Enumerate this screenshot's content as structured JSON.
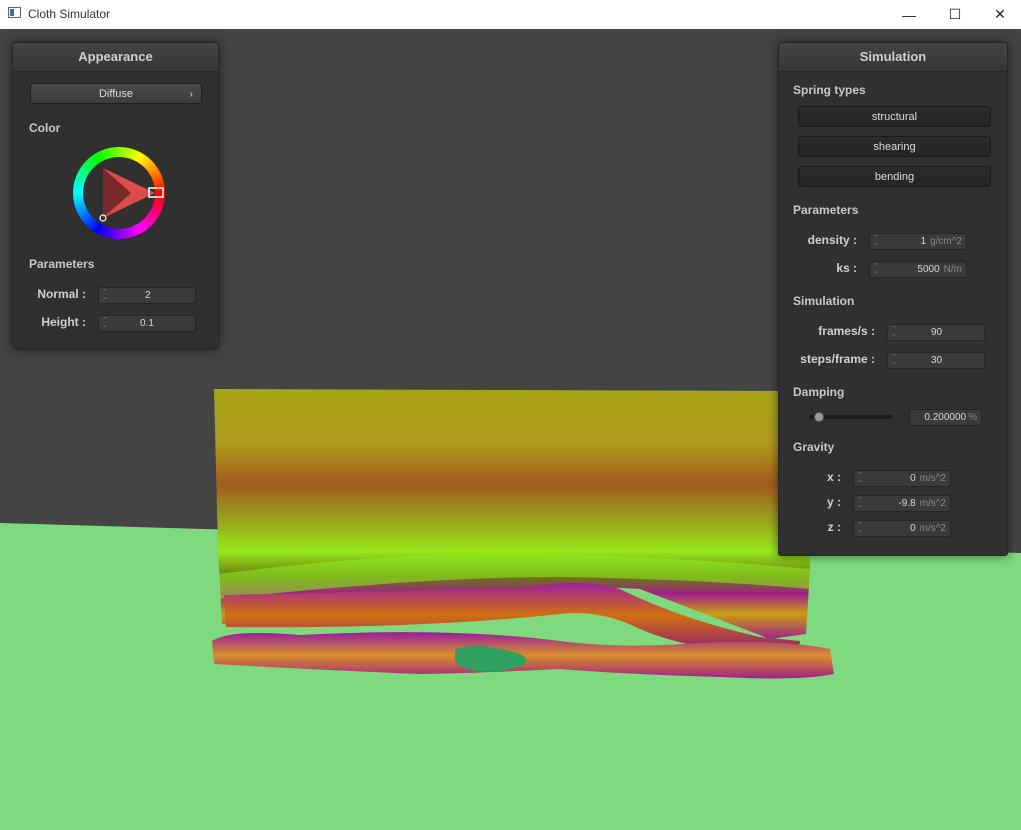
{
  "window": {
    "title": "Cloth Simulator",
    "minimize": "—",
    "maximize": "☐",
    "close": "✕"
  },
  "colors": {
    "ground": "#7ed97f",
    "background": "#444444",
    "panel": "#303030"
  },
  "appearance": {
    "header": "Appearance",
    "shader": "Diffuse",
    "color_label": "Color",
    "parameters_label": "Parameters",
    "normal_label": "Normal :",
    "normal_value": "2",
    "height_label": "Height :",
    "height_value": "0.1",
    "selected_color": "#ff0000"
  },
  "simulation": {
    "header": "Simulation",
    "spring_types_label": "Spring types",
    "springs": [
      "structural",
      "shearing",
      "bending"
    ],
    "parameters_label": "Parameters",
    "density_label": "density :",
    "density_value": "1",
    "density_unit": "g/cm^2",
    "ks_label": "ks :",
    "ks_value": "5000",
    "ks_unit": "N/m",
    "sim_label": "Simulation",
    "fps_label": "frames/s :",
    "fps_value": "90",
    "steps_label": "steps/frame :",
    "steps_value": "30",
    "damping_label": "Damping",
    "damping_value": "0.200000",
    "damping_unit": "%",
    "damping_fraction": 0.2,
    "gravity_label": "Gravity",
    "gx_label": "x :",
    "gx_value": "0",
    "gy_label": "y :",
    "gy_value": "-9.8",
    "gz_label": "z :",
    "gz_value": "0",
    "gravity_unit": "m/s^2"
  }
}
